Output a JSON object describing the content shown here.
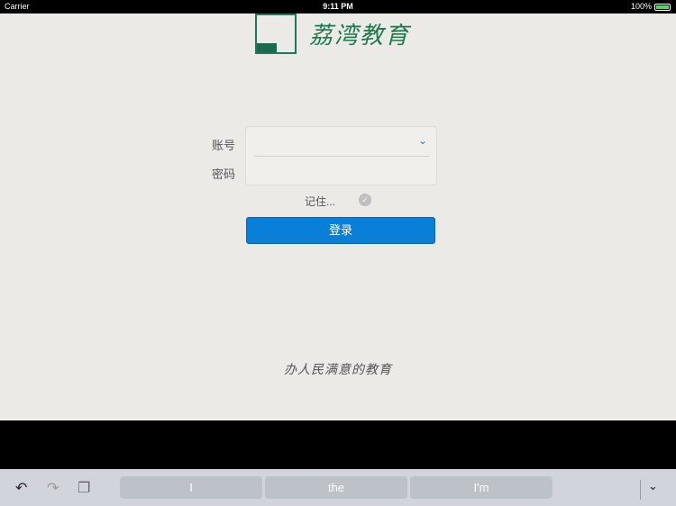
{
  "status": {
    "carrier": "Carrier",
    "time": "9:11 PM",
    "battery": "100%"
  },
  "logo": {
    "text": "荔湾教育"
  },
  "form": {
    "account_label": "账号",
    "password_label": "密码",
    "account_value": "",
    "password_value": "",
    "remember_label": "记住...",
    "login_label": "登录"
  },
  "slogan": "办人民满意的教育",
  "keyboard": {
    "suggestions": [
      "I",
      "the",
      "I'm"
    ]
  }
}
